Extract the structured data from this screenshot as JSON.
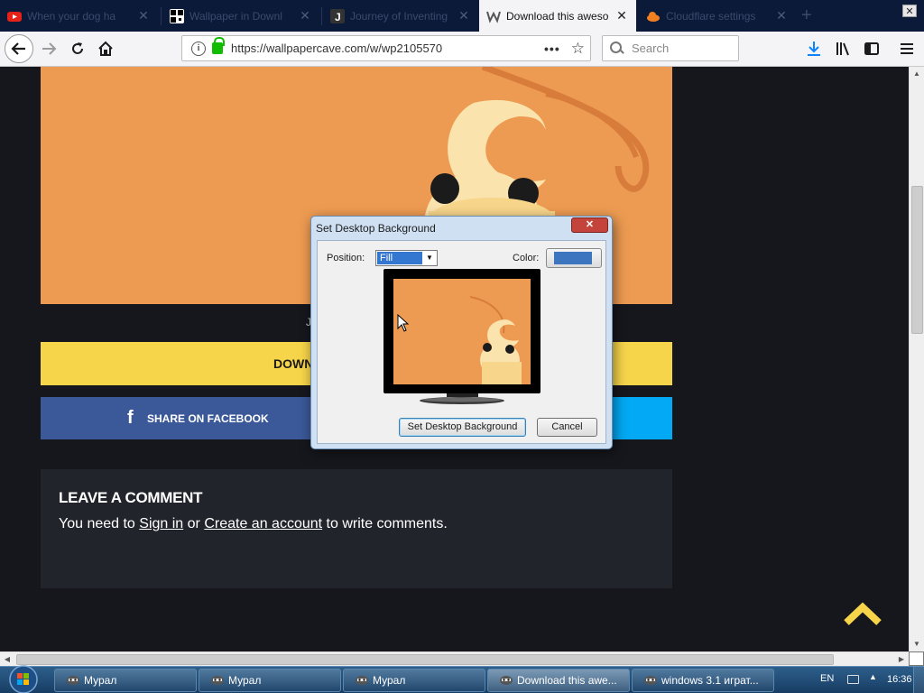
{
  "tabs": [
    {
      "title": "When your dog ha",
      "favicon": "youtube-icon",
      "active": false
    },
    {
      "title": "Wallpaper in Downl",
      "favicon": "qr-icon",
      "active": false
    },
    {
      "title": "Journey of Inventing",
      "favicon": "j-icon",
      "active": false
    },
    {
      "title": "Download this aweso",
      "favicon": "wallpapercave-icon",
      "active": true
    },
    {
      "title": "Cloudflare settings",
      "favicon": "cloudflare-icon",
      "active": false
    }
  ],
  "nav": {
    "url": "https://wallpapercave.com/w/wp2105570",
    "search_placeholder": "Search"
  },
  "page": {
    "caption_stub": "J",
    "download_label": "DOWN",
    "facebook_label": "SHARE ON FACEBOOK",
    "comment": {
      "heading": "LEAVE A COMMENT",
      "text_before": "You need to ",
      "sign_in": "Sign in",
      "text_or": " or ",
      "create_account": "Create an account",
      "text_after": " to write comments."
    }
  },
  "dialog": {
    "title": "Set Desktop Background",
    "position_label": "Position:",
    "position_value": "Fill",
    "color_label": "Color:",
    "color_value": "#3d75bf",
    "set_button": "Set Desktop Background",
    "cancel_button": "Cancel"
  },
  "taskbar": {
    "items": [
      {
        "label": "Мурал",
        "active": false
      },
      {
        "label": "Мурал",
        "active": false
      },
      {
        "label": "Мурал",
        "active": false
      },
      {
        "label": "Download this awe...",
        "active": true
      },
      {
        "label": "windows 3.1 играт...",
        "active": false
      }
    ],
    "lang": "EN",
    "clock": "16:36"
  },
  "colors": {
    "wallpaper": "#ed9b52",
    "download_bar": "#f7d54a",
    "facebook": "#3b5998",
    "twitter": "#03a9f4",
    "scroll_top_arrow": "#f7d54a"
  }
}
